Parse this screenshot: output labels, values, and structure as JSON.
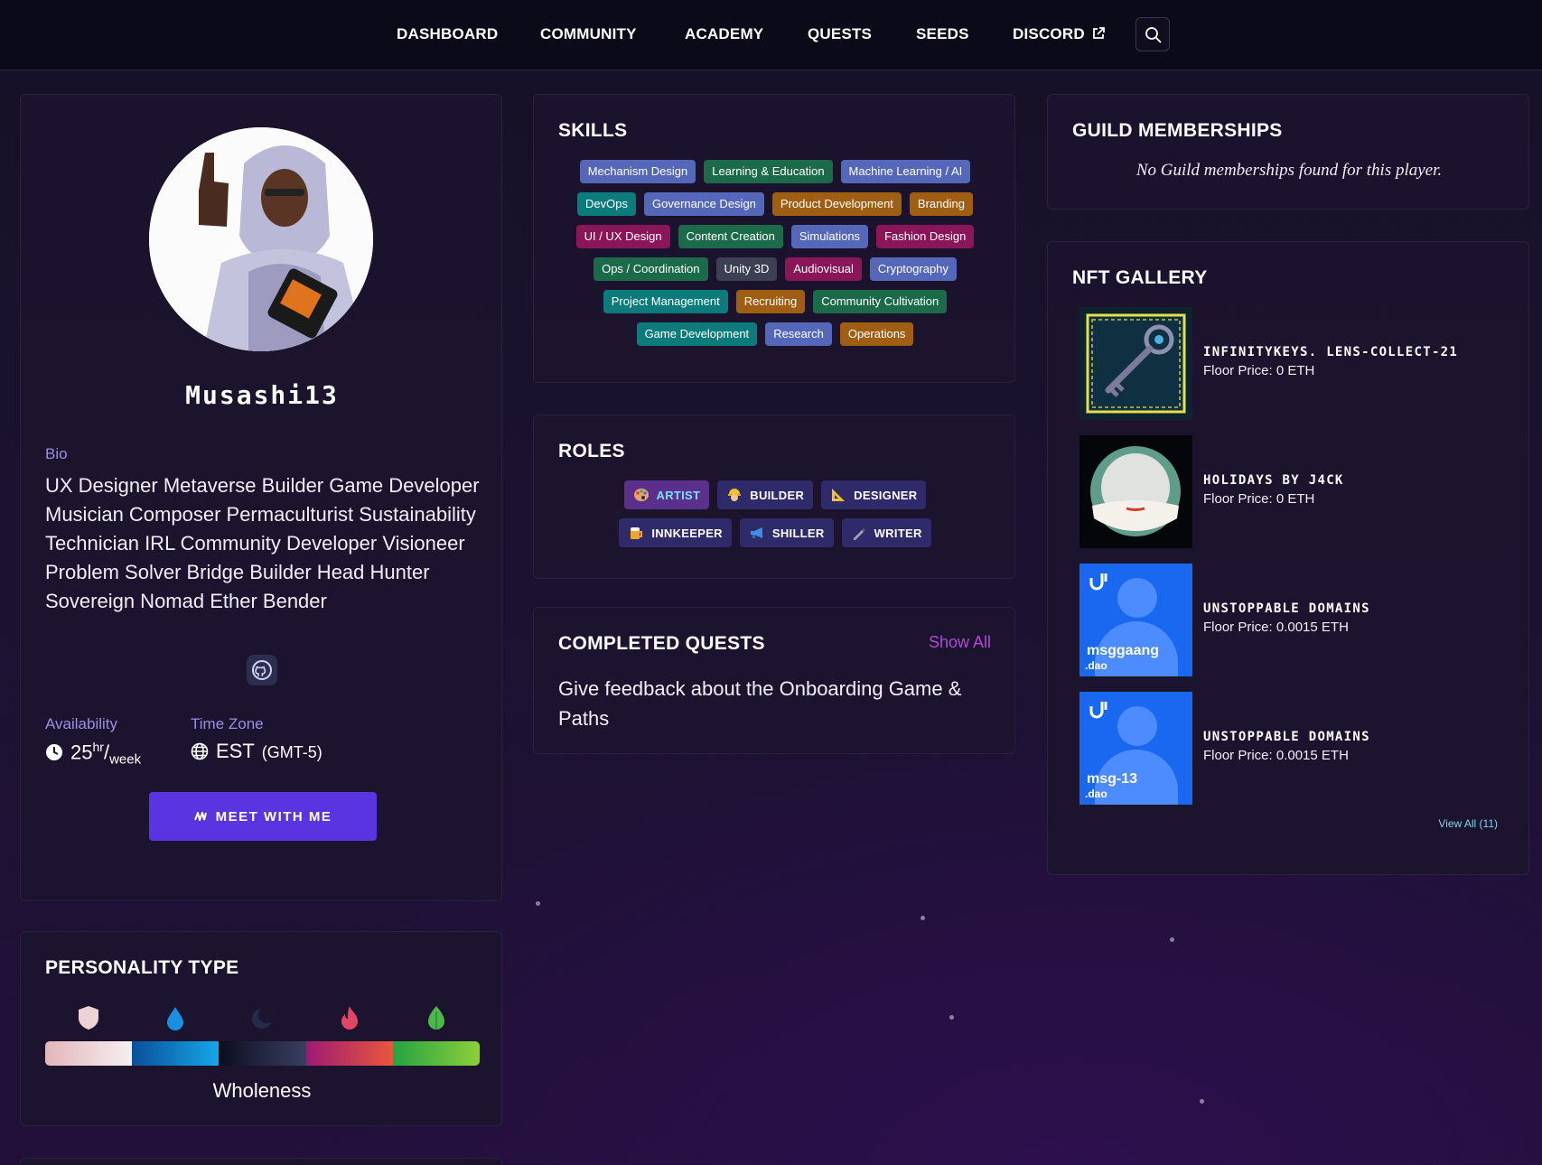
{
  "nav": {
    "links": [
      "DASHBOARD",
      "COMMUNITY",
      "ACADEMY",
      "QUESTS",
      "SEEDS",
      "DISCORD"
    ]
  },
  "profile": {
    "username": "Musashi13",
    "bio_label": "Bio",
    "bio": "UX Designer Metaverse Builder Game Developer Musician Composer Permaculturist Sustainability Technician IRL Community Developer Visioneer Problem Solver Bridge Builder Head Hunter Sovereign Nomad Ether Bender",
    "availability_label": "Availability",
    "availability_value": "25",
    "availability_unit_top": "hr",
    "availability_unit_bottom": "week",
    "timezone_label": "Time Zone",
    "timezone_value": "EST",
    "timezone_offset": "(GMT-5)",
    "meet_button": "MEET WITH ME"
  },
  "personality": {
    "title": "PERSONALITY TYPE",
    "label": "Wholeness",
    "colors": [
      "#e7c7c9",
      "#0f7fd3",
      "#1c2440",
      "#d8465a",
      "#59b847"
    ]
  },
  "skills": {
    "title": "SKILLS",
    "tags": [
      {
        "label": "Mechanism Design",
        "color": "blue"
      },
      {
        "label": "Learning & Education",
        "color": "green"
      },
      {
        "label": "Machine Learning / AI",
        "color": "blue"
      },
      {
        "label": "DevOps",
        "color": "teal"
      },
      {
        "label": "Governance Design",
        "color": "blue"
      },
      {
        "label": "Product Development",
        "color": "orange"
      },
      {
        "label": "Branding",
        "color": "orange"
      },
      {
        "label": "UI / UX Design",
        "color": "maroon"
      },
      {
        "label": "Content Creation",
        "color": "green"
      },
      {
        "label": "Simulations",
        "color": "blue"
      },
      {
        "label": "Fashion Design",
        "color": "maroon"
      },
      {
        "label": "Ops / Coordination",
        "color": "green"
      },
      {
        "label": "Unity 3D",
        "color": "gray"
      },
      {
        "label": "Audiovisual",
        "color": "maroon"
      },
      {
        "label": "Cryptography",
        "color": "blue"
      },
      {
        "label": "Project Management",
        "color": "teal"
      },
      {
        "label": "Recruiting",
        "color": "orange"
      },
      {
        "label": "Community Cultivation",
        "color": "green"
      },
      {
        "label": "Game Development",
        "color": "teal"
      },
      {
        "label": "Research",
        "color": "blue"
      },
      {
        "label": "Operations",
        "color": "orange"
      }
    ]
  },
  "roles": {
    "title": "ROLES",
    "items": [
      {
        "label": "ARTIST",
        "icon": "palette-icon",
        "active": true
      },
      {
        "label": "BUILDER",
        "icon": "construction-worker-icon",
        "active": false
      },
      {
        "label": "DESIGNER",
        "icon": "triangular-ruler-icon",
        "active": false
      },
      {
        "label": "INNKEEPER",
        "icon": "beer-mug-icon",
        "active": false
      },
      {
        "label": "SHILLER",
        "icon": "megaphone-icon",
        "active": false
      },
      {
        "label": "WRITER",
        "icon": "pen-icon",
        "active": false
      }
    ]
  },
  "quests": {
    "title": "COMPLETED QUESTS",
    "show_all": "Show All",
    "items": [
      "Give feedback about the Onboarding Game & Paths"
    ]
  },
  "guilds": {
    "title": "GUILD MEMBERSHIPS",
    "empty": "No Guild memberships found for this player."
  },
  "nfts": {
    "title": "NFT GALLERY",
    "items": [
      {
        "name": "INFINITYKEYS. LENS-COLLECT-21",
        "price": "Floor Price: 0 ETH",
        "thumb": "key-image"
      },
      {
        "name": "HOLIDAYS BY J4CK",
        "price": "Floor Price: 0 ETH",
        "thumb": "snow-globe-image"
      },
      {
        "name": "UNSTOPPABLE DOMAINS",
        "price": "Floor Price: 0.0015 ETH",
        "thumb": "unstoppable-domain-card",
        "domain": "msggaang",
        "tld": ".dao"
      },
      {
        "name": "UNSTOPPABLE DOMAINS",
        "price": "Floor Price: 0.0015 ETH",
        "thumb": "unstoppable-domain-card",
        "domain": "msg-13",
        "tld": ".dao"
      }
    ],
    "view_all": "View All (11)"
  }
}
